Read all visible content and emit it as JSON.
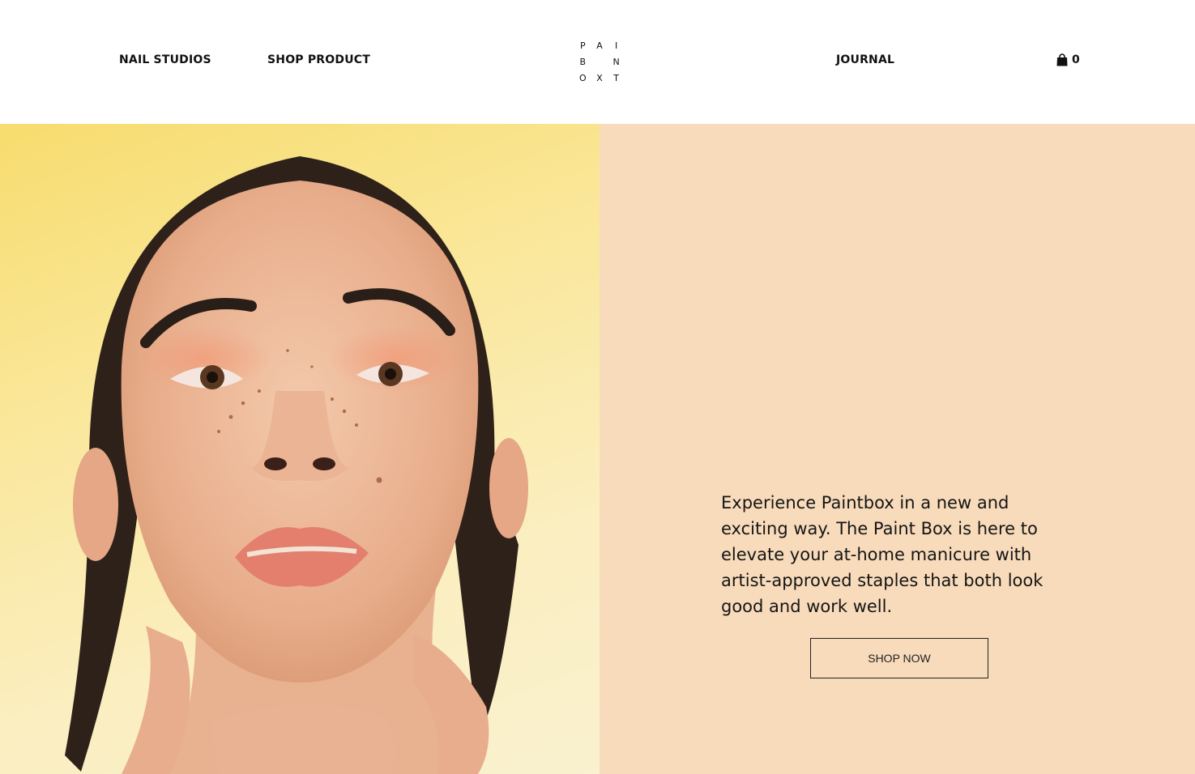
{
  "header": {
    "nav_left": [
      {
        "label": "NAIL STUDIOS"
      },
      {
        "label": "SHOP PRODUCT"
      }
    ],
    "nav_right": [
      {
        "label": "JOURNAL"
      }
    ],
    "logo": {
      "letters": [
        "P",
        "A",
        "I",
        "B",
        "",
        "N",
        "O",
        "X",
        "T"
      ]
    },
    "cart": {
      "icon": "shopping-bag-icon",
      "count": "0"
    }
  },
  "hero": {
    "image": {
      "subject": "portrait photo",
      "background_color": "#f7dc6e"
    },
    "panel": {
      "background_color": "#f8dbbb",
      "text": "Experience Paintbox in a new and exciting way. The Paint Box is here to elevate your at-home manicure with artist-approved staples that both look good and work well.",
      "button_label": "SHOP NOW"
    }
  }
}
